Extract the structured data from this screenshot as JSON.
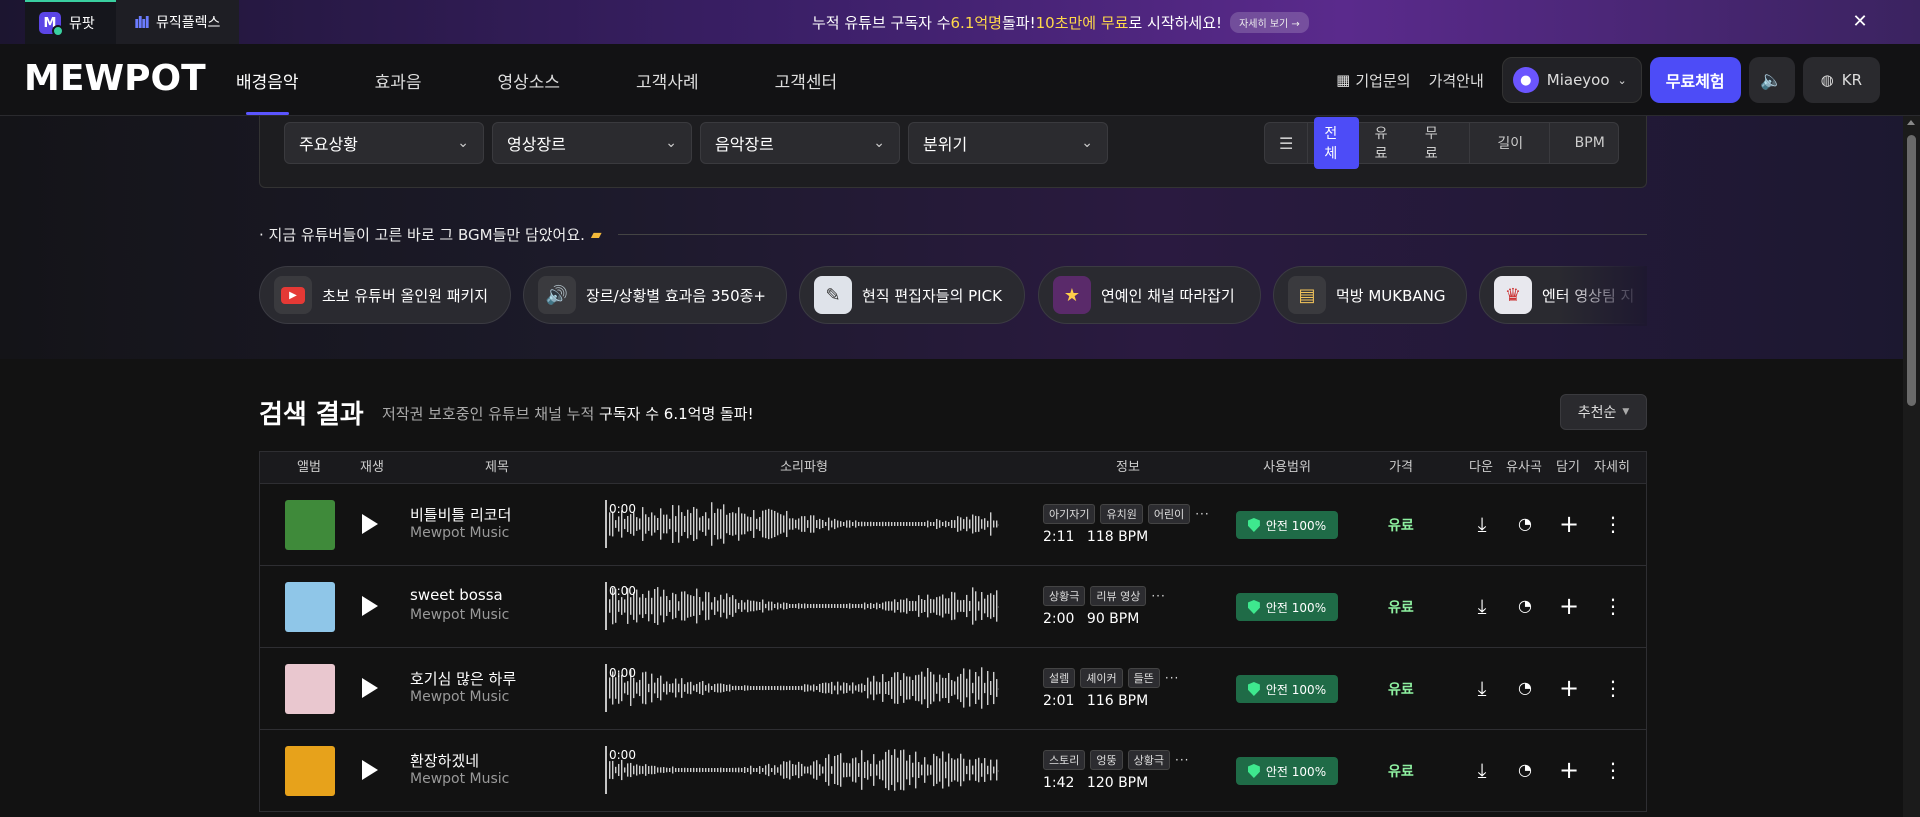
{
  "promo": {
    "tabs": [
      {
        "label": "뮤팟",
        "icon": "mewpot-logo-icon"
      },
      {
        "label": "뮤직플렉스",
        "icon": "soundwave-icon"
      }
    ],
    "text_before": "누적 유튜브 구독자 수 ",
    "text_hl1": "6.1억명",
    "text_mid": " 돌파! ",
    "text_hl2": "10초만에 무료",
    "text_after": "로 시작하세요!",
    "more": "자세히 보기 →",
    "close": "✕"
  },
  "header": {
    "brand": "MEWPOT",
    "nav": [
      "배경음악",
      "효과음",
      "영상소스",
      "고객사례",
      "고객센터"
    ],
    "enterprise": "기업문의",
    "pricing": "가격안내",
    "user": "Miaeyoo",
    "trial": "무료체험",
    "lang": "KR"
  },
  "filters": {
    "dropdowns": [
      "주요상황",
      "영상장르",
      "음악장르",
      "분위기"
    ],
    "price_options": [
      "전체",
      "유료",
      "무료"
    ],
    "length": "길이",
    "bpm": "BPM"
  },
  "curation": {
    "heading": "· 지금 유튜버들이 고른 바로 그 BGM들만 담았어요.",
    "chips": [
      {
        "label": "초보 유튜버 올인원 패키지",
        "icon": "youtube-icon"
      },
      {
        "label": "장르/상황별 효과음 350종+",
        "icon": "speaker-icon"
      },
      {
        "label": "현직 편집자들의 PICK",
        "icon": "editor-icon"
      },
      {
        "label": "연예인 채널 따라잡기",
        "icon": "celebrity-icon"
      },
      {
        "label": "먹방 MUKBANG",
        "icon": "sandwich-icon"
      },
      {
        "label": "엔터 영상팀 지",
        "icon": "entertainment-icon"
      }
    ]
  },
  "results": {
    "title": "검색 결과",
    "subtitle_prefix": "저작권 보호중인 유튜브 채널 누적 ",
    "subtitle_bold": "구독자 수 6.1억명 돌파!",
    "sort": "추천순",
    "columns": [
      "앨범",
      "재생",
      "제목",
      "소리파형",
      "정보",
      "사용범위",
      "가격",
      "다운",
      "유사곡",
      "담기",
      "자세히"
    ],
    "tracks": [
      {
        "title": "비틀비틀 리코더",
        "artist": "Mewpot Music",
        "tags": [
          "아기자기",
          "유치원",
          "어린이"
        ],
        "duration": "2:11",
        "bpm": "118 BPM",
        "usage": "안전 100%",
        "price": "유료",
        "time": "0:00",
        "cover": "#3f8a3a"
      },
      {
        "title": "sweet bossa",
        "artist": "Mewpot Music",
        "tags": [
          "상황극",
          "리뷰 영상"
        ],
        "duration": "2:00",
        "bpm": "90 BPM",
        "usage": "안전 100%",
        "price": "유료",
        "time": "0:00",
        "cover": "#8fc6e8"
      },
      {
        "title": "호기심 많은 하루",
        "artist": "Mewpot Music",
        "tags": [
          "설렘",
          "셰이커",
          "들뜬"
        ],
        "duration": "2:01",
        "bpm": "116 BPM",
        "usage": "안전 100%",
        "price": "유료",
        "time": "0:00",
        "cover": "#e9c7cf"
      },
      {
        "title": "환장하겠네",
        "artist": "Mewpot Music",
        "tags": [
          "스토리",
          "엉뚱",
          "상황극"
        ],
        "duration": "1:42",
        "bpm": "120 BPM",
        "usage": "안전 100%",
        "price": "유료",
        "time": "0:00",
        "cover": "#e7a21b"
      }
    ]
  },
  "colors": {
    "accent": "#4d4cf7",
    "safe_badge": "#1f6b47",
    "price_paid": "#8ef0a0",
    "promo_highlight": "#ffd84a"
  }
}
